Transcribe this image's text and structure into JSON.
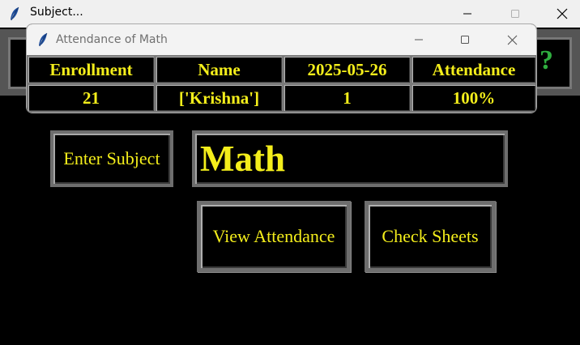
{
  "main_window": {
    "title": "Subject...",
    "app_icon": "feather-icon",
    "background_symbol": "?"
  },
  "popup_window": {
    "title": "Attendance of Math",
    "app_icon": "feather-icon",
    "table": {
      "headers": [
        "Enrollment",
        "Name",
        "2025-05-26",
        "Attendance"
      ],
      "rows": [
        [
          "21",
          "['Krishna']",
          "1",
          "100%"
        ]
      ]
    }
  },
  "form": {
    "subject_label": "Enter Subject",
    "subject_value": "Math",
    "view_attendance_label": "View Attendance",
    "check_sheets_label": "Check Sheets"
  },
  "colors": {
    "text_accent": "#f4ee1b",
    "background": "#000000",
    "border": "#6e6e6e"
  }
}
